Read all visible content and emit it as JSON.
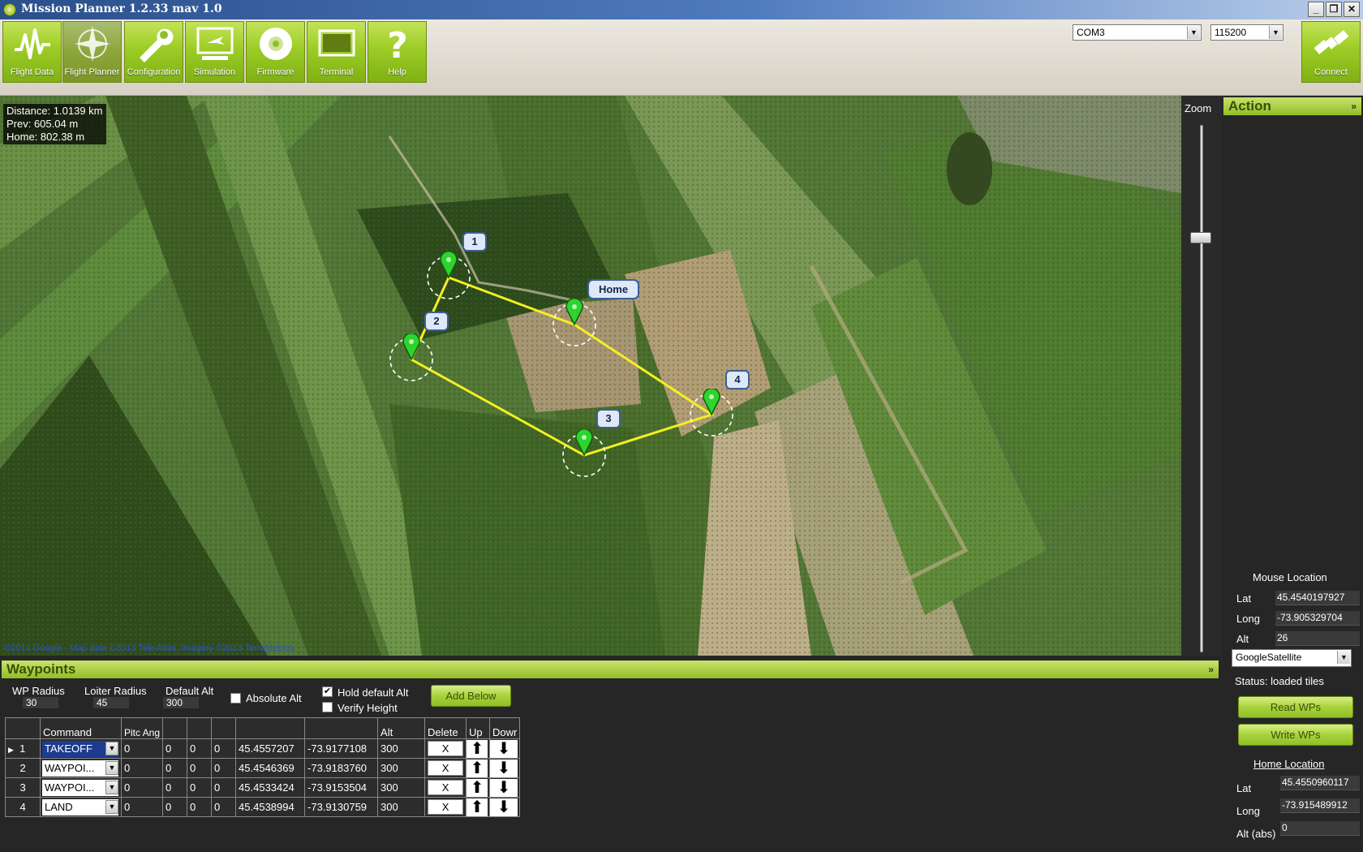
{
  "window": {
    "title": "Mission Planner 1.2.33 mav 1.0",
    "controls": {
      "minimize": "_",
      "restore": "❐",
      "close": "✕"
    }
  },
  "toolbar": {
    "buttons": [
      {
        "label": "Flight Data",
        "icon": "pulse-icon"
      },
      {
        "label": "Flight Planner",
        "icon": "compass-icon"
      },
      {
        "label": "Configuration",
        "icon": "wrench-icon"
      },
      {
        "label": "Simulation",
        "icon": "monitor-plane-icon"
      },
      {
        "label": "Firmware",
        "icon": "disc-icon"
      },
      {
        "label": "Terminal",
        "icon": "terminal-icon"
      },
      {
        "label": "Help",
        "icon": "question-icon"
      }
    ],
    "port": "COM3",
    "baud": "115200",
    "connect_label": "Connect"
  },
  "map": {
    "distance": "Distance: 1.0139 km",
    "prev": "Prev: 605.04 m",
    "home": "Home: 802.38 m",
    "copyright": "©2013 Google - Map data ©2013 Tele Atlas, Imagery ©2013 TerraMetrics",
    "markers": {
      "home": "Home",
      "wp1": "1",
      "wp2": "2",
      "wp3": "3",
      "wp4": "4"
    },
    "zoom_label": "Zoom"
  },
  "action_panel": {
    "title": "Action",
    "collapse": "»",
    "mouse_location_title": "Mouse Location",
    "lat_label": "Lat",
    "lat_value": "45.4540197927",
    "long_label": "Long",
    "long_value": "-73.905329704",
    "alt_label": "Alt",
    "alt_value": "26",
    "map_type": "GoogleSatellite",
    "status": "Status: loaded tiles",
    "read_wps": "Read WPs",
    "write_wps": "Write WPs",
    "home_location_title": "Home Location",
    "home_lat_label": "Lat",
    "home_lat_value": "45.4550960117",
    "home_long_label": "Long",
    "home_long_value": "-73.915489912",
    "home_alt_label": "Alt (abs)",
    "home_alt_value": "0"
  },
  "waypoints": {
    "title": "Waypoints",
    "collapse": "»",
    "wp_radius_label": "WP Radius",
    "wp_radius_value": "30",
    "loiter_radius_label": "Loiter Radius",
    "loiter_radius_value": "45",
    "default_alt_label": "Default Alt",
    "default_alt_value": "300",
    "absolute_alt_label": "Absolute Alt",
    "hold_default_alt_label": "Hold default Alt",
    "verify_height_label": "Verify Height",
    "add_below": "Add Below",
    "columns": {
      "command": "Command",
      "pitch": "Pitc Ang",
      "alt": "Alt",
      "delete": "Delete",
      "up": "Up",
      "down": "Dowr"
    },
    "rows": [
      {
        "num": "1",
        "command": "TAKEOFF",
        "p1": "0",
        "p2": "0",
        "p3": "0",
        "p4": "0",
        "lat": "45.4557207",
        "lon": "-73.9177108",
        "alt": "300",
        "del": "X"
      },
      {
        "num": "2",
        "command": "WAYPOI...",
        "p1": "0",
        "p2": "0",
        "p3": "0",
        "p4": "0",
        "lat": "45.4546369",
        "lon": "-73.9183760",
        "alt": "300",
        "del": "X"
      },
      {
        "num": "3",
        "command": "WAYPOI...",
        "p1": "0",
        "p2": "0",
        "p3": "0",
        "p4": "0",
        "lat": "45.4533424",
        "lon": "-73.9153504",
        "alt": "300",
        "del": "X"
      },
      {
        "num": "4",
        "command": "LAND",
        "p1": "0",
        "p2": "0",
        "p3": "0",
        "p4": "0",
        "lat": "45.4538994",
        "lon": "-73.9130759",
        "alt": "300",
        "del": "X"
      }
    ]
  }
}
